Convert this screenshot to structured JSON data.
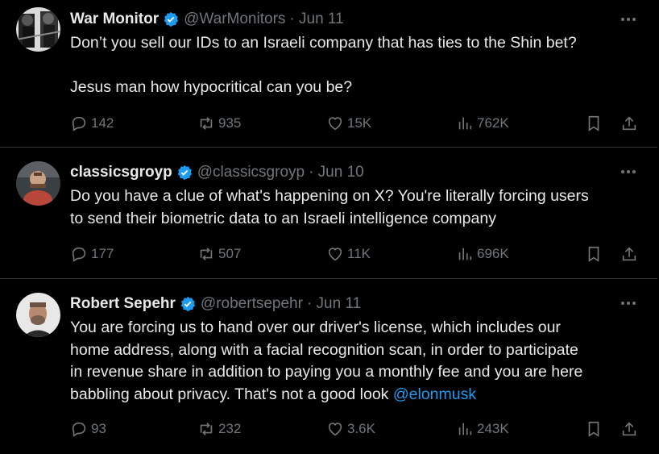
{
  "tweets": [
    {
      "author": "War Monitor",
      "handle": "@WarMonitors",
      "date": "· Jun 11",
      "text": [
        "Don’t you sell our IDs to an Israeli company that has ties to the Shin bet?",
        "Jesus man how hypocritical can you be?"
      ],
      "replies": "142",
      "reposts": "935",
      "likes": "15K",
      "views": "762K"
    },
    {
      "author": "classicsgroyp",
      "handle": "@classicsgroyp",
      "date": "· Jun 10",
      "text": [
        "Do you have a clue of what's happening on X? You're literally forcing users",
        "to send their biometric data to an Israeli intelligence company"
      ],
      "replies": "177",
      "reposts": "507",
      "likes": "11K",
      "views": "696K"
    },
    {
      "author": "Robert Sepehr",
      "handle": "@robertsepehr",
      "date": "· Jun 11",
      "text": [
        "You are forcing us to hand over our driver's license, which includes our",
        "home address, along with a facial recognition scan, in order to participate",
        "in revenue share in addition to paying you a monthly fee and you are here",
        "babbling about privacy. That's not a good look"
      ],
      "mention": "@elonmusk",
      "replies": "93",
      "reposts": "232",
      "likes": "3.6K",
      "views": "243K"
    }
  ],
  "colors": {
    "background": "#000000",
    "text": "#e7e9ea",
    "muted": "#71767b",
    "accent": "#1d9bf0",
    "divider": "#2f3336"
  },
  "icons": [
    "verified-badge-icon",
    "more-icon",
    "reply-icon",
    "repost-icon",
    "like-icon",
    "views-icon",
    "bookmark-icon",
    "share-icon"
  ]
}
